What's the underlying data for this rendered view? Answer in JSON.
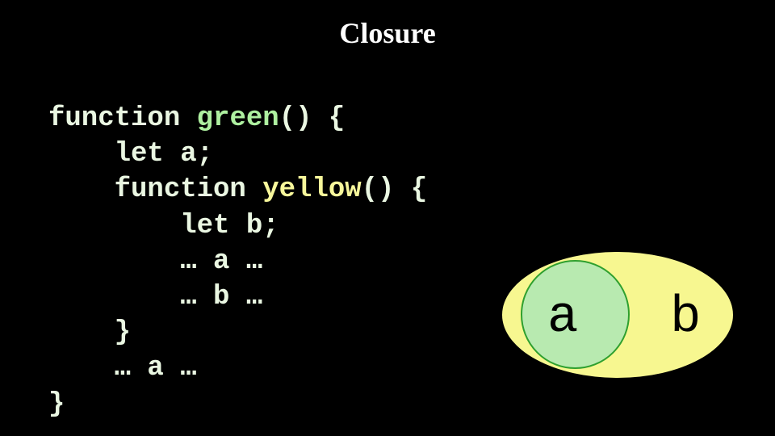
{
  "title": "Closure",
  "code": {
    "l1": {
      "kw": "function ",
      "name": "green",
      "after": "() {"
    },
    "l2": "    let a;",
    "l3": {
      "kw": "    function ",
      "name": "yellow",
      "after": "() {"
    },
    "l4": "        let b;",
    "l5": "        … a …",
    "l6": "        … b …",
    "l7": "    }",
    "l8": "    … a …",
    "l9": "}"
  },
  "diagram": {
    "inner_label": "a",
    "outer_label": "b"
  }
}
